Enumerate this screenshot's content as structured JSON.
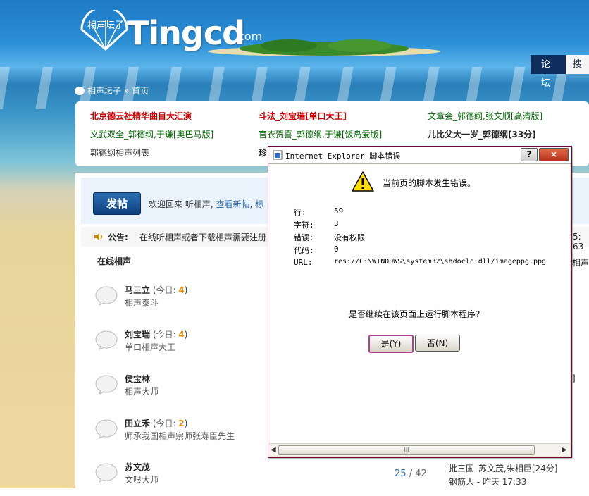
{
  "site": {
    "logo_text": "Tingcd",
    "logo_suffix": "com",
    "logo_badge": "相声坛子"
  },
  "nav": {
    "active_tab": "论坛",
    "next_tab": "搜"
  },
  "breadcrumb": {
    "home": "相声坛子",
    "sep": "»",
    "current": "首页"
  },
  "featured_links": [
    {
      "text": "北京德云社精华曲目大汇演",
      "style": "red"
    },
    {
      "text": "斗法_刘宝瑞[单口大王]",
      "style": "red"
    },
    {
      "text": "文章会_郭德纲,张文顺[高清版]",
      "style": "grn"
    },
    {
      "text": "文武双全_郭德纲,于谦[奥巴马版]",
      "style": "grn"
    },
    {
      "text": "官衣贺喜_郭德纲,于谦[饭岛爱版]",
      "style": "grn"
    },
    {
      "text": "儿比父大一岁_郭德纲[33分]",
      "style": "blk"
    },
    {
      "text": "郭德纲相声列表",
      "style": "gry"
    },
    {
      "text": "珍",
      "style": "blk"
    }
  ],
  "toolbar": {
    "post_button": "发帖",
    "welcome": "欢迎回来 听相声,",
    "new_posts": "查看新帖",
    "more": "标"
  },
  "notice": {
    "label": "公告:",
    "text": "在线听相声或者下载相声需要注册",
    "right": "5: 63"
  },
  "section": {
    "title": "在线相声",
    "right_text": "相声"
  },
  "forums": [
    {
      "name": "马三立",
      "today_label": "今日:",
      "count": "4",
      "desc": "相声泰斗"
    },
    {
      "name": "刘宝瑞",
      "today_label": "今日:",
      "count": "4",
      "desc": "单口相声大王"
    },
    {
      "name": "侯宝林",
      "today_label": "",
      "count": "",
      "desc": "相声大师"
    },
    {
      "name": "田立禾",
      "today_label": "今日:",
      "count": "2",
      "desc": "师承我国相声宗师张寿臣先生"
    },
    {
      "name": "苏文茂",
      "today_label": "",
      "count": "",
      "desc": "文哏大师"
    }
  ],
  "last_row": {
    "topics": "25",
    "sep": "/",
    "posts": "42",
    "last_title": "批三国_苏文茂,朱相臣[24分]",
    "last_user": "钢筋人 - 昨天 17:33"
  },
  "right_bracket": "]",
  "dialog": {
    "title": "Internet Explorer 脚本错误",
    "help_btn": "?",
    "close_btn": "×",
    "message": "当前页的脚本发生错误。",
    "fields": [
      {
        "label": "行:",
        "value": "59"
      },
      {
        "label": "字符:",
        "value": "3"
      },
      {
        "label": "错误:",
        "value": "没有权限"
      },
      {
        "label": "代码:",
        "value": "0"
      },
      {
        "label": "URL:",
        "value": "res://C:\\WINDOWS\\system32\\shdoclc.dll/imageppg.ppg"
      }
    ],
    "question": "是否继续在该页面上运行脚本程序?",
    "yes_button": "是(Y)",
    "no_button": "否(N)",
    "scroll_left": "◀",
    "scroll_right": "▶",
    "scroll_grip": "III"
  }
}
